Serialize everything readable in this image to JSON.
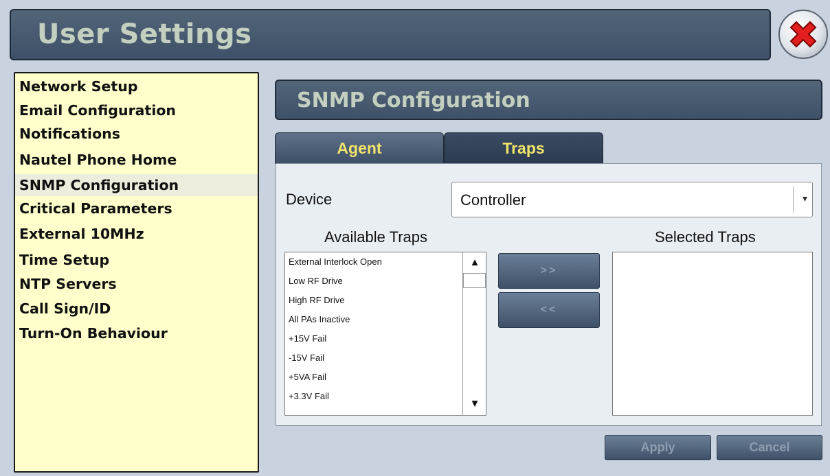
{
  "header": {
    "title": "User Settings"
  },
  "sidebar": {
    "items": [
      {
        "label": "Network Setup"
      },
      {
        "label": "Email Configuration"
      },
      {
        "label": "Notifications"
      },
      {
        "label": "Nautel Phone Home"
      },
      {
        "label": "SNMP Configuration"
      },
      {
        "label": "Critical Parameters"
      },
      {
        "label": "External 10MHz"
      },
      {
        "label": "Time Setup"
      },
      {
        "label": "NTP Servers"
      },
      {
        "label": "Call Sign/ID"
      },
      {
        "label": "Turn-On Behaviour"
      }
    ],
    "selected": "SNMP Configuration"
  },
  "section": {
    "title": "SNMP Configuration"
  },
  "tabs": [
    {
      "label": "Agent"
    },
    {
      "label": "Traps"
    }
  ],
  "active_tab": "Traps",
  "device": {
    "label": "Device",
    "value": "Controller"
  },
  "available": {
    "label": "Available Traps",
    "items": [
      "External Interlock Open",
      "Low RF Drive",
      "High RF Drive",
      "All PAs Inactive",
      "+15V Fail",
      "-15V Fail",
      "+5VA Fail",
      "+3.3V Fail"
    ]
  },
  "selected_traps": {
    "label": "Selected Traps",
    "items": []
  },
  "buttons": {
    "add": ">>",
    "remove": "<<",
    "apply": "Apply",
    "cancel": "Cancel"
  },
  "colors": {
    "title_bar": "#46586e",
    "title_text": "#c4d0bf",
    "tab_text": "#f2e46a",
    "sidebar_bg": "#ffffcc",
    "background": "#c9d3df"
  },
  "icons": {
    "close": "close-x-icon",
    "scroll_up": "arrow-up-icon",
    "scroll_down": "arrow-down-icon",
    "dropdown": "caret-down-icon"
  }
}
